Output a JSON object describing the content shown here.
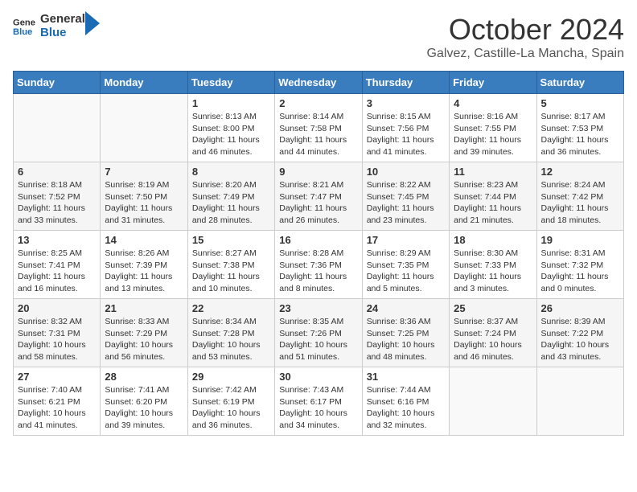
{
  "header": {
    "logo_line1": "General",
    "logo_line2": "Blue",
    "month_title": "October 2024",
    "location": "Galvez, Castille-La Mancha, Spain"
  },
  "weekdays": [
    "Sunday",
    "Monday",
    "Tuesday",
    "Wednesday",
    "Thursday",
    "Friday",
    "Saturday"
  ],
  "weeks": [
    [
      {
        "day": "",
        "sunrise": "",
        "sunset": "",
        "daylight": ""
      },
      {
        "day": "",
        "sunrise": "",
        "sunset": "",
        "daylight": ""
      },
      {
        "day": "1",
        "sunrise": "Sunrise: 8:13 AM",
        "sunset": "Sunset: 8:00 PM",
        "daylight": "Daylight: 11 hours and 46 minutes."
      },
      {
        "day": "2",
        "sunrise": "Sunrise: 8:14 AM",
        "sunset": "Sunset: 7:58 PM",
        "daylight": "Daylight: 11 hours and 44 minutes."
      },
      {
        "day": "3",
        "sunrise": "Sunrise: 8:15 AM",
        "sunset": "Sunset: 7:56 PM",
        "daylight": "Daylight: 11 hours and 41 minutes."
      },
      {
        "day": "4",
        "sunrise": "Sunrise: 8:16 AM",
        "sunset": "Sunset: 7:55 PM",
        "daylight": "Daylight: 11 hours and 39 minutes."
      },
      {
        "day": "5",
        "sunrise": "Sunrise: 8:17 AM",
        "sunset": "Sunset: 7:53 PM",
        "daylight": "Daylight: 11 hours and 36 minutes."
      }
    ],
    [
      {
        "day": "6",
        "sunrise": "Sunrise: 8:18 AM",
        "sunset": "Sunset: 7:52 PM",
        "daylight": "Daylight: 11 hours and 33 minutes."
      },
      {
        "day": "7",
        "sunrise": "Sunrise: 8:19 AM",
        "sunset": "Sunset: 7:50 PM",
        "daylight": "Daylight: 11 hours and 31 minutes."
      },
      {
        "day": "8",
        "sunrise": "Sunrise: 8:20 AM",
        "sunset": "Sunset: 7:49 PM",
        "daylight": "Daylight: 11 hours and 28 minutes."
      },
      {
        "day": "9",
        "sunrise": "Sunrise: 8:21 AM",
        "sunset": "Sunset: 7:47 PM",
        "daylight": "Daylight: 11 hours and 26 minutes."
      },
      {
        "day": "10",
        "sunrise": "Sunrise: 8:22 AM",
        "sunset": "Sunset: 7:45 PM",
        "daylight": "Daylight: 11 hours and 23 minutes."
      },
      {
        "day": "11",
        "sunrise": "Sunrise: 8:23 AM",
        "sunset": "Sunset: 7:44 PM",
        "daylight": "Daylight: 11 hours and 21 minutes."
      },
      {
        "day": "12",
        "sunrise": "Sunrise: 8:24 AM",
        "sunset": "Sunset: 7:42 PM",
        "daylight": "Daylight: 11 hours and 18 minutes."
      }
    ],
    [
      {
        "day": "13",
        "sunrise": "Sunrise: 8:25 AM",
        "sunset": "Sunset: 7:41 PM",
        "daylight": "Daylight: 11 hours and 16 minutes."
      },
      {
        "day": "14",
        "sunrise": "Sunrise: 8:26 AM",
        "sunset": "Sunset: 7:39 PM",
        "daylight": "Daylight: 11 hours and 13 minutes."
      },
      {
        "day": "15",
        "sunrise": "Sunrise: 8:27 AM",
        "sunset": "Sunset: 7:38 PM",
        "daylight": "Daylight: 11 hours and 10 minutes."
      },
      {
        "day": "16",
        "sunrise": "Sunrise: 8:28 AM",
        "sunset": "Sunset: 7:36 PM",
        "daylight": "Daylight: 11 hours and 8 minutes."
      },
      {
        "day": "17",
        "sunrise": "Sunrise: 8:29 AM",
        "sunset": "Sunset: 7:35 PM",
        "daylight": "Daylight: 11 hours and 5 minutes."
      },
      {
        "day": "18",
        "sunrise": "Sunrise: 8:30 AM",
        "sunset": "Sunset: 7:33 PM",
        "daylight": "Daylight: 11 hours and 3 minutes."
      },
      {
        "day": "19",
        "sunrise": "Sunrise: 8:31 AM",
        "sunset": "Sunset: 7:32 PM",
        "daylight": "Daylight: 11 hours and 0 minutes."
      }
    ],
    [
      {
        "day": "20",
        "sunrise": "Sunrise: 8:32 AM",
        "sunset": "Sunset: 7:31 PM",
        "daylight": "Daylight: 10 hours and 58 minutes."
      },
      {
        "day": "21",
        "sunrise": "Sunrise: 8:33 AM",
        "sunset": "Sunset: 7:29 PM",
        "daylight": "Daylight: 10 hours and 56 minutes."
      },
      {
        "day": "22",
        "sunrise": "Sunrise: 8:34 AM",
        "sunset": "Sunset: 7:28 PM",
        "daylight": "Daylight: 10 hours and 53 minutes."
      },
      {
        "day": "23",
        "sunrise": "Sunrise: 8:35 AM",
        "sunset": "Sunset: 7:26 PM",
        "daylight": "Daylight: 10 hours and 51 minutes."
      },
      {
        "day": "24",
        "sunrise": "Sunrise: 8:36 AM",
        "sunset": "Sunset: 7:25 PM",
        "daylight": "Daylight: 10 hours and 48 minutes."
      },
      {
        "day": "25",
        "sunrise": "Sunrise: 8:37 AM",
        "sunset": "Sunset: 7:24 PM",
        "daylight": "Daylight: 10 hours and 46 minutes."
      },
      {
        "day": "26",
        "sunrise": "Sunrise: 8:39 AM",
        "sunset": "Sunset: 7:22 PM",
        "daylight": "Daylight: 10 hours and 43 minutes."
      }
    ],
    [
      {
        "day": "27",
        "sunrise": "Sunrise: 7:40 AM",
        "sunset": "Sunset: 6:21 PM",
        "daylight": "Daylight: 10 hours and 41 minutes."
      },
      {
        "day": "28",
        "sunrise": "Sunrise: 7:41 AM",
        "sunset": "Sunset: 6:20 PM",
        "daylight": "Daylight: 10 hours and 39 minutes."
      },
      {
        "day": "29",
        "sunrise": "Sunrise: 7:42 AM",
        "sunset": "Sunset: 6:19 PM",
        "daylight": "Daylight: 10 hours and 36 minutes."
      },
      {
        "day": "30",
        "sunrise": "Sunrise: 7:43 AM",
        "sunset": "Sunset: 6:17 PM",
        "daylight": "Daylight: 10 hours and 34 minutes."
      },
      {
        "day": "31",
        "sunrise": "Sunrise: 7:44 AM",
        "sunset": "Sunset: 6:16 PM",
        "daylight": "Daylight: 10 hours and 32 minutes."
      },
      {
        "day": "",
        "sunrise": "",
        "sunset": "",
        "daylight": ""
      },
      {
        "day": "",
        "sunrise": "",
        "sunset": "",
        "daylight": ""
      }
    ]
  ]
}
